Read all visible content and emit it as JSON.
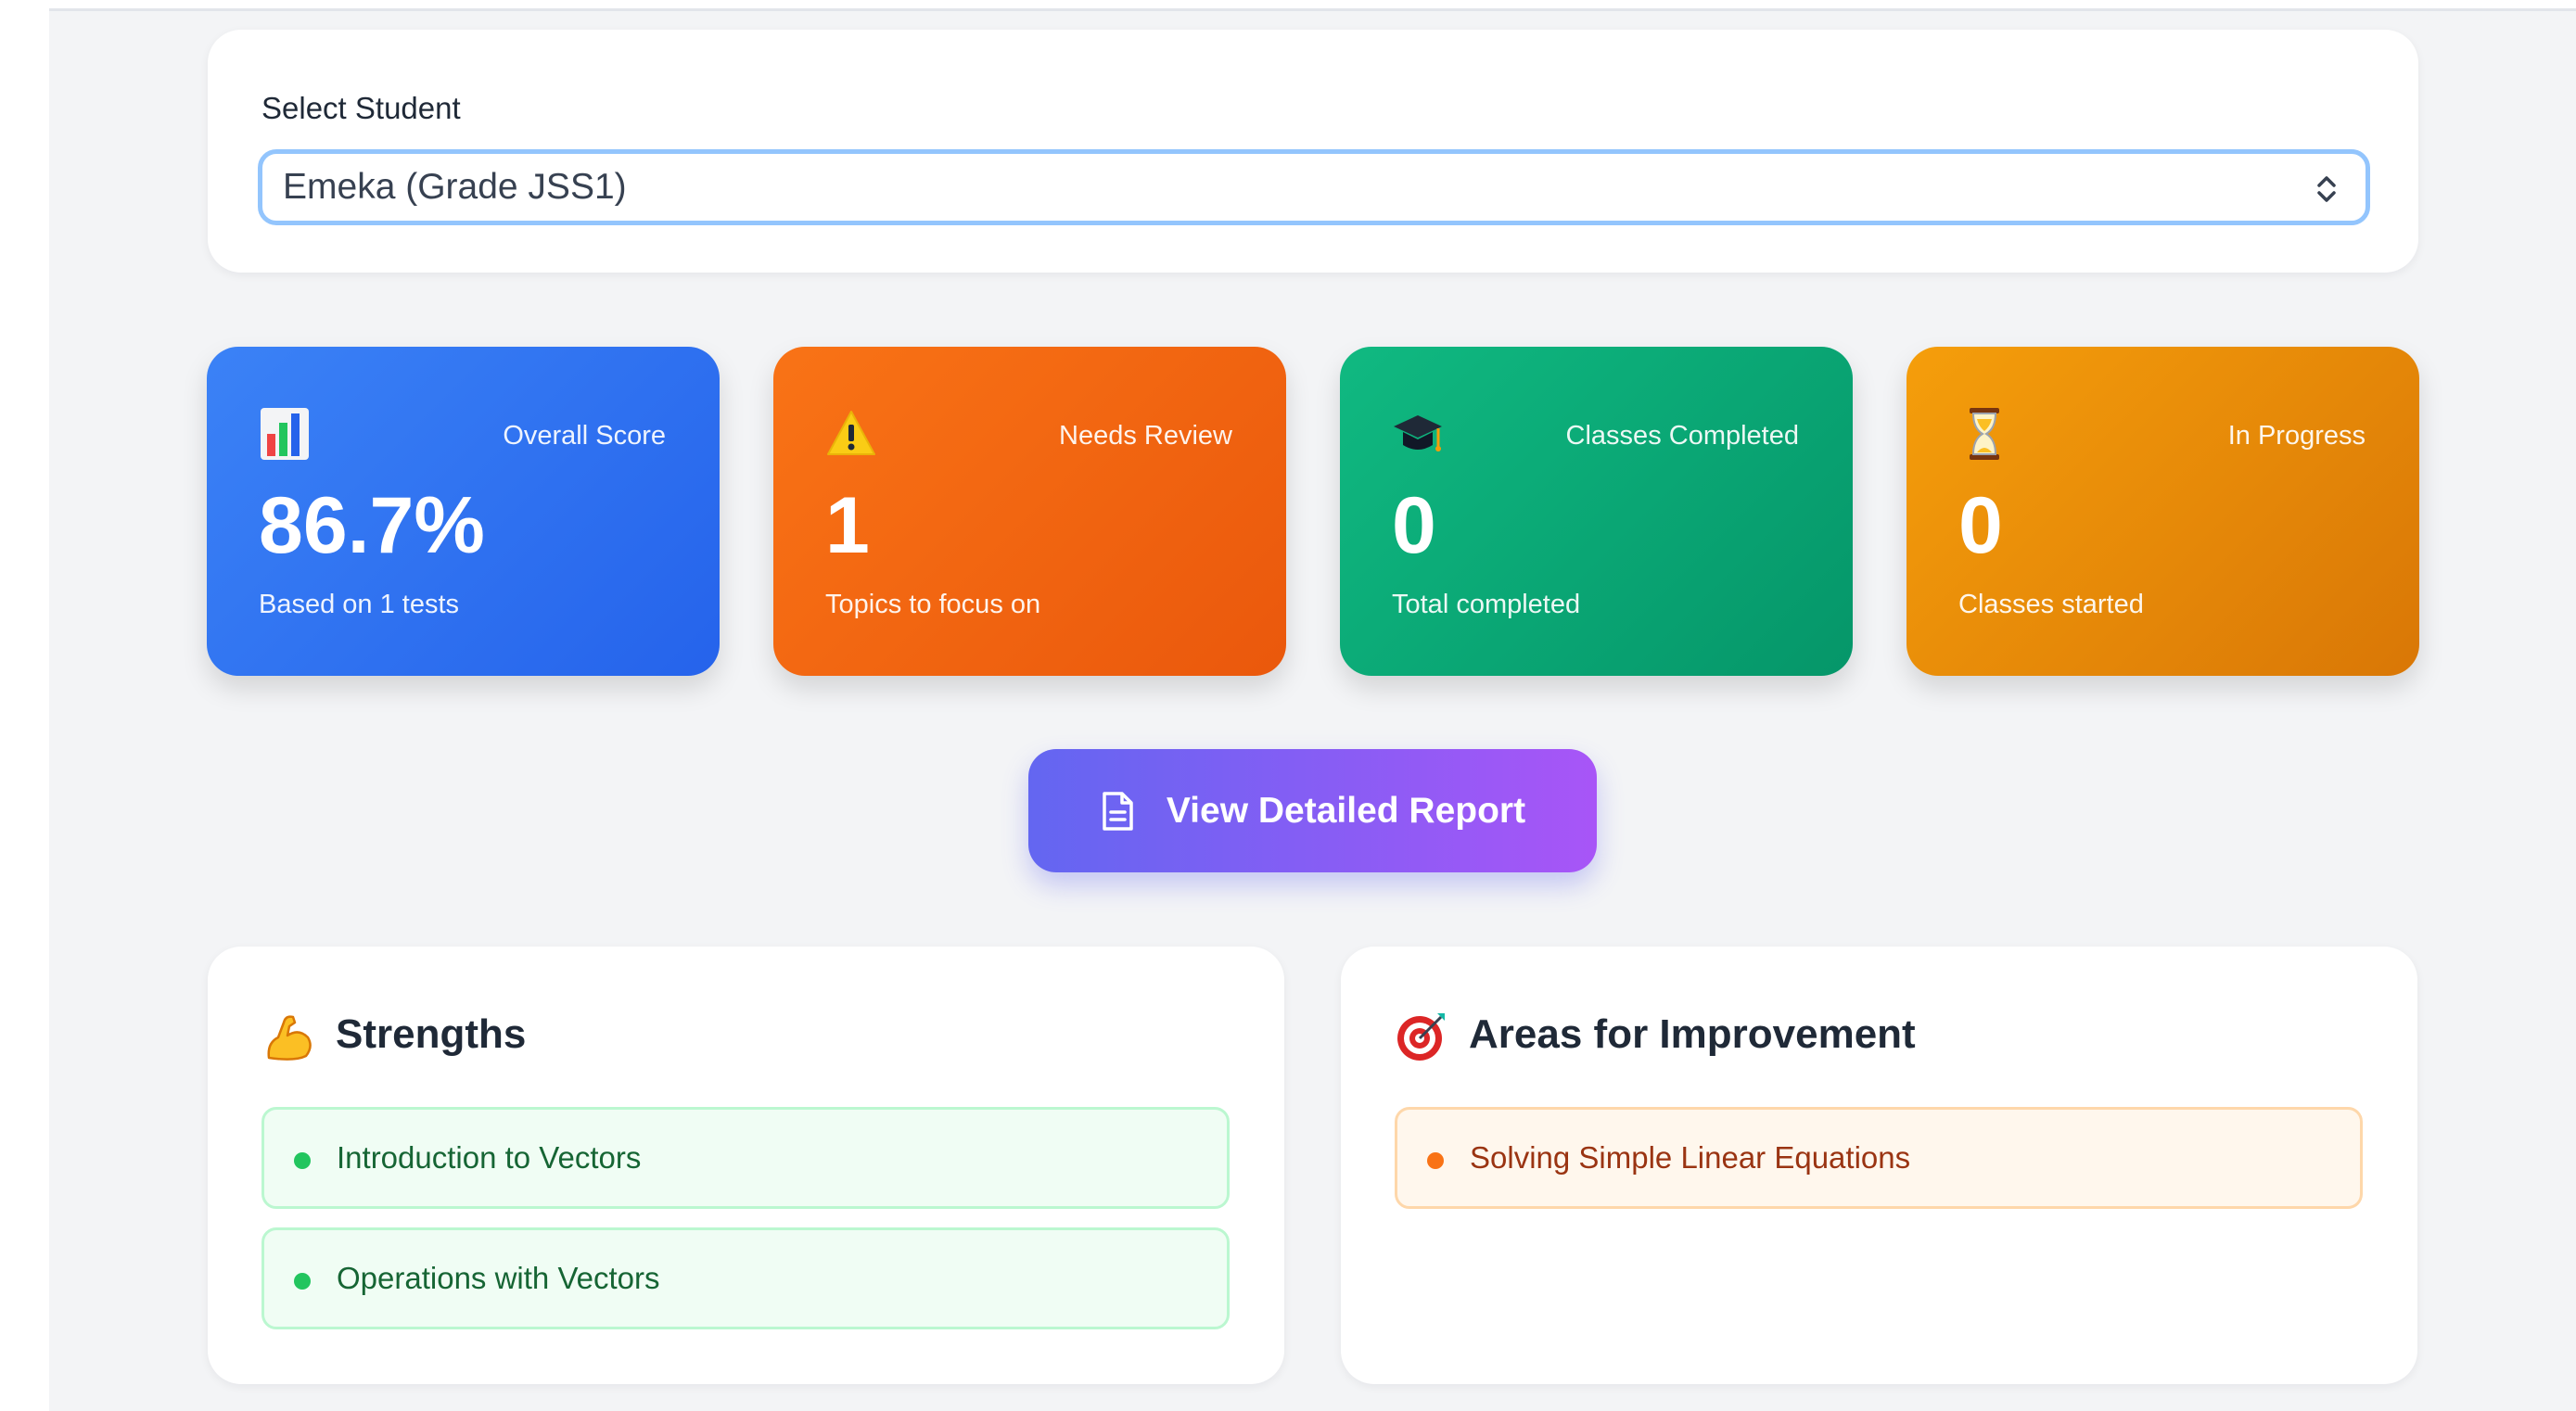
{
  "selector": {
    "label": "Select Student",
    "selected_value": "Emeka (Grade JSS1)"
  },
  "stats": [
    {
      "icon": "bar-chart-icon",
      "label": "Overall Score",
      "value": "86.7%",
      "sub": "Based on 1 tests",
      "color": "#3b82f6"
    },
    {
      "icon": "warning-icon",
      "label": "Needs Review",
      "value": "1",
      "sub": "Topics to focus on",
      "color": "#f97316"
    },
    {
      "icon": "graduation-cap-icon",
      "label": "Classes Completed",
      "value": "0",
      "sub": "Total completed",
      "color": "#10b981"
    },
    {
      "icon": "hourglass-icon",
      "label": "In Progress",
      "value": "0",
      "sub": "Classes started",
      "color": "#f59e0b"
    }
  ],
  "report_button": {
    "label": "View Detailed Report",
    "icon": "document-icon"
  },
  "strengths": {
    "title": "Strengths",
    "icon": "flexed-biceps-icon",
    "items": [
      "Introduction to Vectors",
      "Operations with Vectors"
    ]
  },
  "improvement": {
    "title": "Areas for Improvement",
    "icon": "target-icon",
    "items": [
      "Solving Simple Linear Equations"
    ]
  }
}
